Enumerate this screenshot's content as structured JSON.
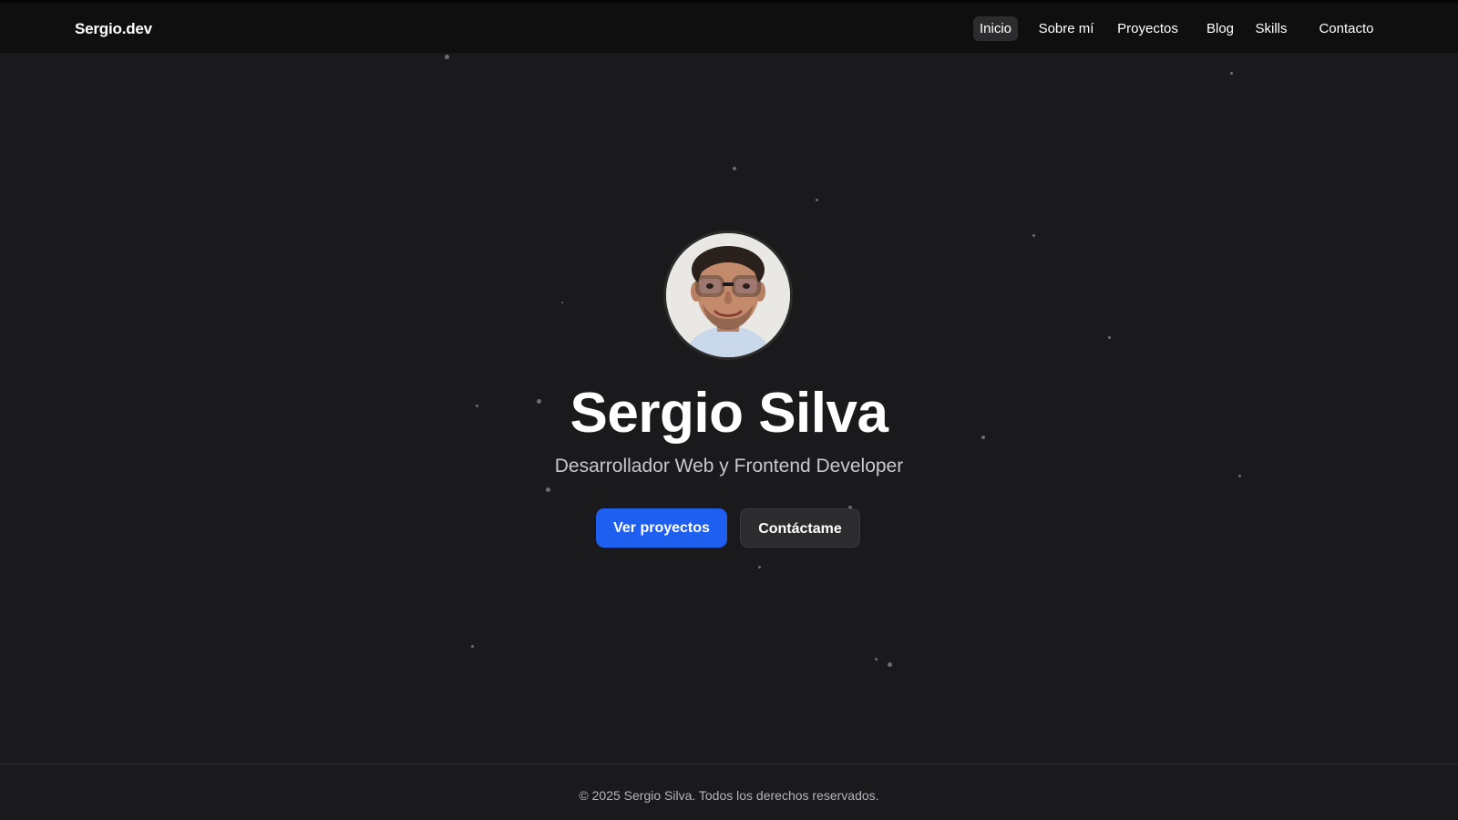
{
  "header": {
    "brand": "Sergio.dev",
    "nav": [
      {
        "label": "Inicio",
        "active": true
      },
      {
        "label": "Sobre mí",
        "active": false
      },
      {
        "label": "Proyectos",
        "active": false
      },
      {
        "label": "Blog",
        "active": false
      },
      {
        "label": "Skills",
        "active": false
      },
      {
        "label": "Contacto",
        "active": false
      }
    ]
  },
  "hero": {
    "avatar_icon": "profile-photo",
    "name": "Sergio Silva",
    "subtitle": "Desarrollador Web y Frontend Developer",
    "primary_button": "Ver proyectos",
    "secondary_button": "Contáctame"
  },
  "footer": {
    "text": "© 2025 Sergio Silva. Todos los derechos reservados."
  },
  "colors": {
    "background": "#1a1a1c",
    "header_background": "#0f0f10",
    "accent": "#1e5ff0",
    "secondary_button": "#2c2c2e"
  }
}
